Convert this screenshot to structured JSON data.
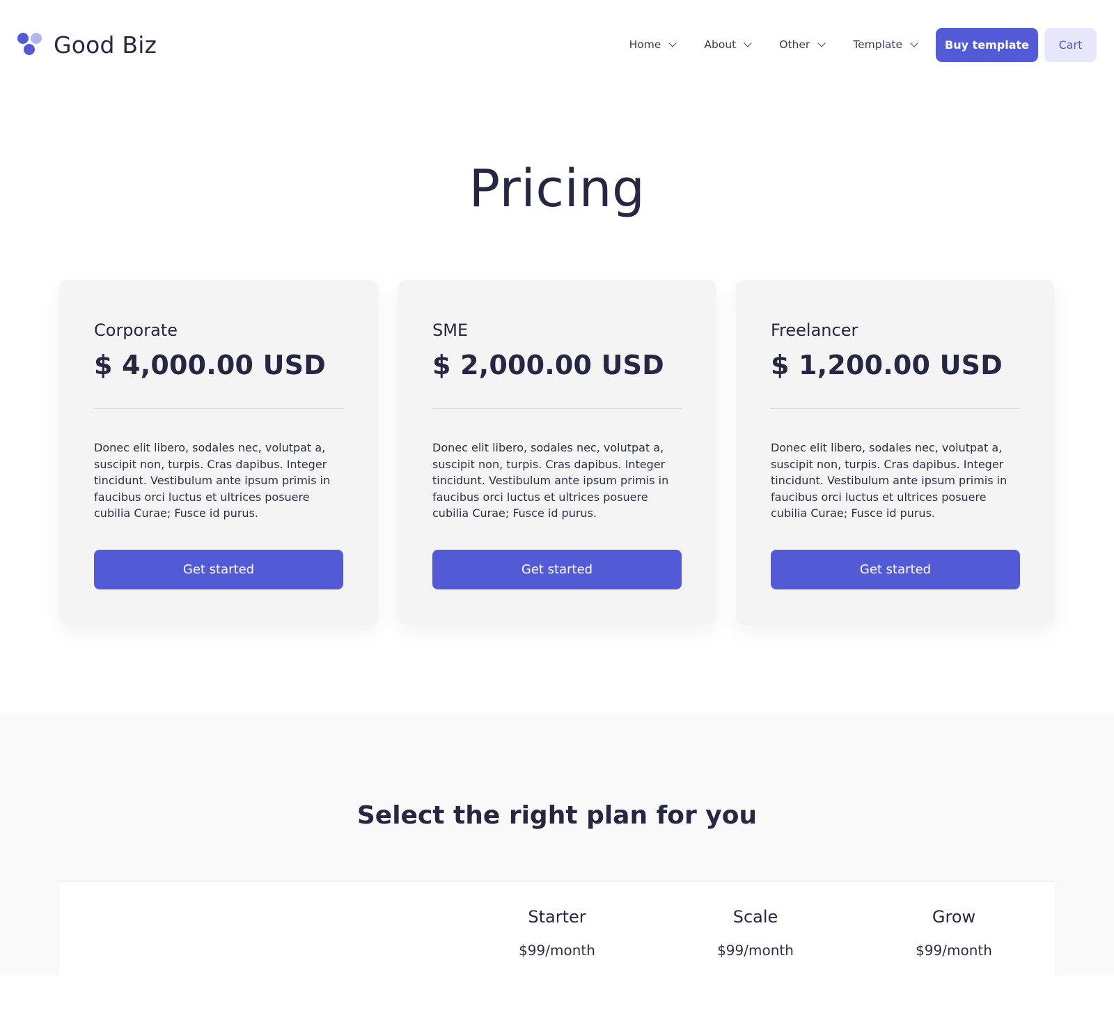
{
  "brand": {
    "name": "Good Biz"
  },
  "nav": {
    "items": [
      {
        "label": "Home"
      },
      {
        "label": "About"
      },
      {
        "label": "Other"
      },
      {
        "label": "Template"
      }
    ],
    "buy_label": "Buy template",
    "cart_label": "Cart"
  },
  "hero": {
    "title": "Pricing"
  },
  "plans": [
    {
      "name": "Corporate",
      "price": "$ 4,000.00 USD",
      "description": "Donec elit libero, sodales nec, volutpat a, suscipit non, turpis. Cras dapibus. Integer tincidunt. Vestibulum ante ipsum primis in faucibus orci luctus et ultrices posuere cubilia Curae; Fusce id purus.",
      "cta": "Get started"
    },
    {
      "name": "SME",
      "price": "$ 2,000.00 USD",
      "description": "Donec elit libero, sodales nec, volutpat a, suscipit non, turpis. Cras dapibus. Integer tincidunt. Vestibulum ante ipsum primis in faucibus orci luctus et ultrices posuere cubilia Curae; Fusce id purus.",
      "cta": "Get started"
    },
    {
      "name": "Freelancer",
      "price": "$ 1,200.00 USD",
      "description": "Donec elit libero, sodales nec, volutpat a, suscipit non, turpis. Cras dapibus. Integer tincidunt. Vestibulum ante ipsum primis in faucibus orci luctus et ultrices posuere cubilia Curae; Fusce id purus.",
      "cta": "Get started"
    }
  ],
  "compare": {
    "title": "Select the right plan for you",
    "columns": [
      {
        "name": "Starter",
        "price": "$99/month"
      },
      {
        "name": "Scale",
        "price": "$99/month"
      },
      {
        "name": "Grow",
        "price": "$99/month"
      }
    ]
  },
  "colors": {
    "accent": "#525bd5",
    "accent_light": "#e6e7fa",
    "text": "#262742",
    "card_bg": "#f4f4f4"
  }
}
